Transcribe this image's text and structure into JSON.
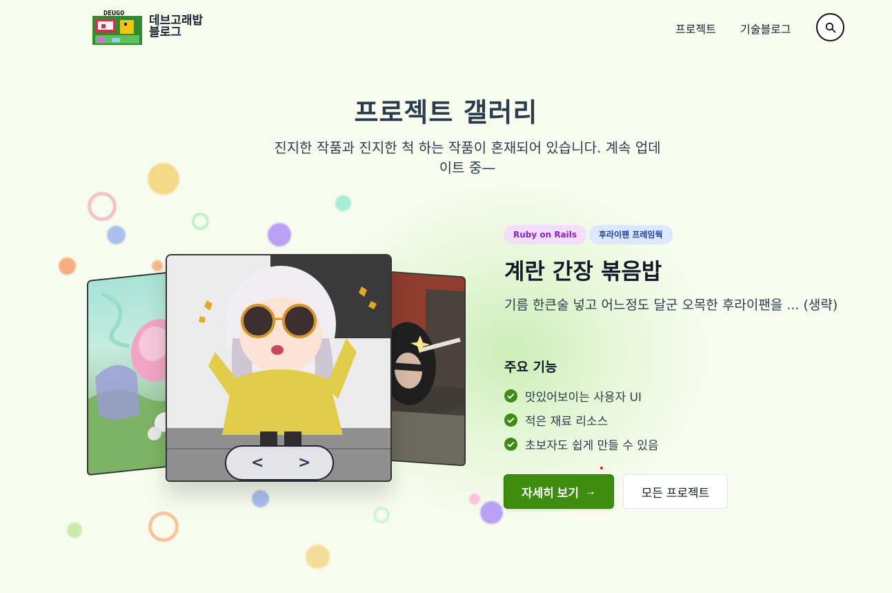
{
  "header": {
    "logo_badge": "DEUGO",
    "logo_text": "데브고래밥 블로그",
    "nav": [
      {
        "label": "프로젝트"
      },
      {
        "label": "기술블로그"
      }
    ],
    "search_icon": "search-icon"
  },
  "hero": {
    "title": "프로젝트 갤러리",
    "subtitle": "진지한 작품과 진지한 척 하는 작품이 혼재되어 있습니다. 계속 업데이트 중—"
  },
  "carousel": {
    "prev_label": "<",
    "next_label": ">"
  },
  "project": {
    "tags": [
      {
        "label": "Ruby on Rails",
        "color": "#8a1fc9",
        "bg": "#f2defc"
      },
      {
        "label": "후라이팬 프레임웍",
        "color": "#1d3fa8",
        "bg": "#dbe8fd"
      }
    ],
    "title": "계란 간장 볶음밥",
    "description": "기름 한큰술 넣고 어느정도 달군 오목한 후라이팬을 ... (생략)",
    "features_title": "주요 기능",
    "features": [
      {
        "label": "맛있어보이는 사용자 UI"
      },
      {
        "label": "적은 재료 리소스"
      },
      {
        "label": "초보자도 쉽게 만들 수 있음"
      }
    ],
    "primary_button": "자세히 보기",
    "primary_arrow": "→",
    "secondary_button": "모든 프로젝트"
  },
  "colors": {
    "accent": "#3d8d0e",
    "background": "#f7fcee",
    "title": "#2a3b4f"
  }
}
